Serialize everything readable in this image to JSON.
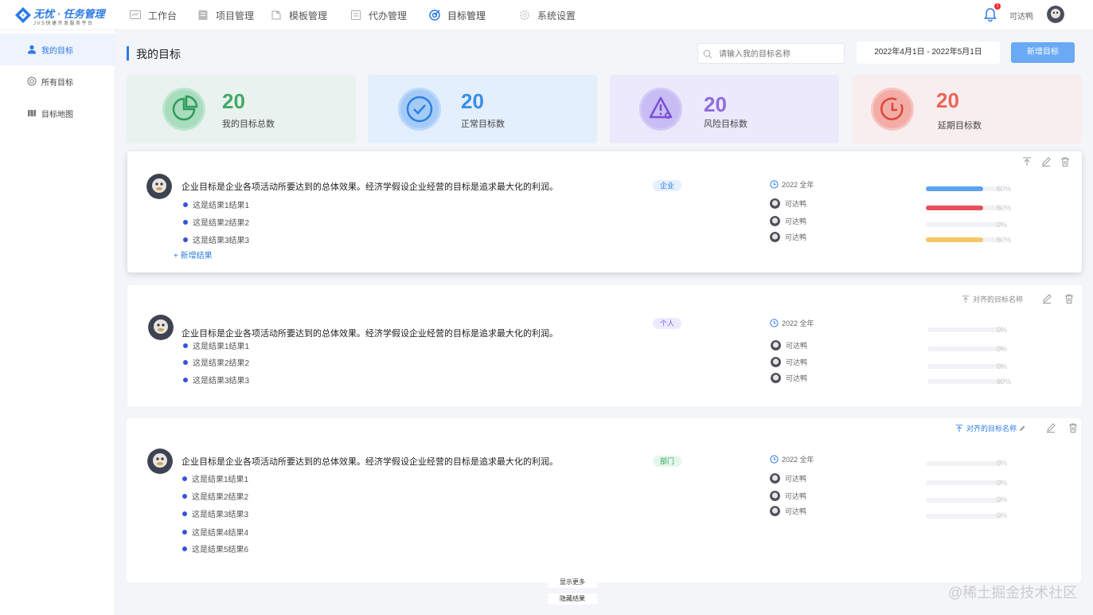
{
  "app": {
    "logo_title": "无忧 · 任务管理",
    "logo_sub": "JVS快捷开发服务平台"
  },
  "topnav": [
    {
      "label": "工作台",
      "icon": "dashboard-icon"
    },
    {
      "label": "项目管理",
      "icon": "project-icon"
    },
    {
      "label": "模板管理",
      "icon": "template-icon"
    },
    {
      "label": "代办管理",
      "icon": "todo-icon"
    },
    {
      "label": "目标管理",
      "icon": "target-icon",
      "active": true
    },
    {
      "label": "系统设置",
      "icon": "settings-icon"
    }
  ],
  "header": {
    "notification_count": "1",
    "user_name": "可达鸭"
  },
  "sidebar": [
    {
      "label": "我的目标",
      "active": true,
      "icon": "user-icon"
    },
    {
      "label": "所有目标",
      "icon": "target-icon"
    },
    {
      "label": "目标地图",
      "icon": "map-icon"
    }
  ],
  "page": {
    "title": "我的目标",
    "search_placeholder": "请输入我的目标名称",
    "date_range": "2022年4月1日 - 2022年5月1日",
    "new_button": "新增目标"
  },
  "stats": [
    {
      "value": "20",
      "label": "我的目标总数",
      "color": "#43a969",
      "bg": "#e8f3ef",
      "icon": "pie-chart-icon"
    },
    {
      "value": "20",
      "label": "正常目标数",
      "color": "#3a8ee6",
      "bg": "#e3effd",
      "icon": "check-circle-icon"
    },
    {
      "value": "20",
      "label": "风险目标数",
      "color": "#8f6ddc",
      "bg": "#ebe9fb",
      "icon": "warning-icon"
    },
    {
      "value": "20",
      "label": "延期目标数",
      "color": "#e96659",
      "bg": "#f9eeef",
      "icon": "clock-icon"
    }
  ],
  "goals": [
    {
      "text": "企业目标是企业各项活动所要达到的总体效果。经济学假设企业经营的目标是追求最大化的利润。",
      "tag": "企业",
      "tag_color": "#2c7be5",
      "tag_bg": "#e6f0fd",
      "period": "2022 全年",
      "results": [
        "这是结果1结果1",
        "这是结果2结果2",
        "这是结果3结果3"
      ],
      "owners": [
        "可达鸭",
        "可达鸭",
        "可达鸭"
      ],
      "add_result": "新增结果",
      "align_label": "",
      "progress": [
        {
          "value": 0.6,
          "label": "60%",
          "color": "#5aa3f0"
        },
        {
          "value": 0.6,
          "label": "60%",
          "color": "#e9505a"
        },
        {
          "value": 0,
          "label": "0%",
          "color": "#f1f2f5"
        },
        {
          "value": 0.6,
          "label": "60%",
          "color": "#f3c766"
        }
      ]
    },
    {
      "text": "企业目标是企业各项活动所要达到的总体效果。经济学假设企业经营的目标是追求最大化的利润。",
      "tag": "个人",
      "tag_color": "#7b61ff",
      "tag_bg": "#eeeafd",
      "period": "2022 全年",
      "results": [
        "这是结果1结果1",
        "这是结果2结果2",
        "这是结果3结果3"
      ],
      "owners": [
        "可达鸭",
        "可达鸭",
        "可达鸭"
      ],
      "align_label": "对齐的目标名称",
      "progress": [
        {
          "value": 0,
          "label": "0%"
        },
        {
          "value": 0,
          "label": "0%"
        },
        {
          "value": 0,
          "label": "0%"
        },
        {
          "value": 0,
          "label": "60%"
        }
      ]
    },
    {
      "text": "企业目标是企业各项活动所要达到的总体效果。经济学假设企业经营的目标是追求最大化的利润。",
      "tag": "部门",
      "tag_color": "#2fa55a",
      "tag_bg": "#e6f6ec",
      "period": "2022 全年",
      "results": [
        "这是结果1结果1",
        "这是结果2结果2",
        "这是结果3结果3",
        "这是结果4结果4",
        "这是结果5结果6"
      ],
      "owners": [
        "可达鸭",
        "可达鸭",
        "可达鸭"
      ],
      "align_label": "对齐的目标名称",
      "progress": [
        {
          "value": 0,
          "label": "0%"
        },
        {
          "value": 0,
          "label": "0%"
        },
        {
          "value": 0,
          "label": "0%"
        },
        {
          "value": 0,
          "label": "0%"
        }
      ]
    }
  ],
  "footer": {
    "show_more": "显示更多",
    "hide_results": "隐藏结果"
  },
  "watermark": "@稀土掘金技术社区"
}
